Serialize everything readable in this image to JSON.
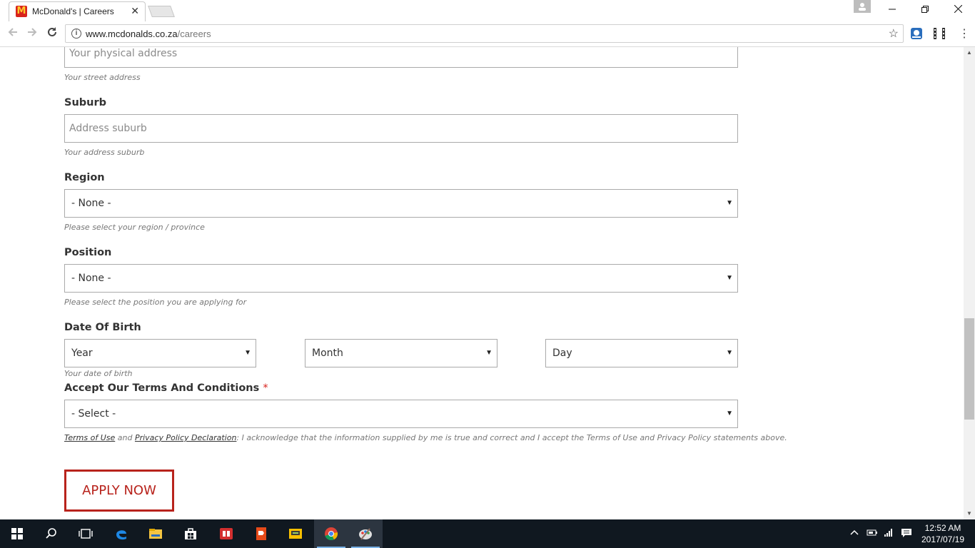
{
  "browser": {
    "tab_title": "McDonald's | Careers",
    "tab_close": "✕",
    "url_host": "www.mcdonalds.co.za",
    "url_path": "/careers"
  },
  "form": {
    "address": {
      "placeholder": "Your physical address",
      "help": "Your street address"
    },
    "suburb": {
      "label": "Suburb",
      "placeholder": "Address suburb",
      "help": "Your address suburb"
    },
    "region": {
      "label": "Region",
      "value": "- None -",
      "help": "Please select your region / province"
    },
    "position": {
      "label": "Position",
      "value": "- None -",
      "help": "Please select the position you are applying for"
    },
    "dob": {
      "label": "Date Of Birth",
      "year": "Year",
      "month": "Month",
      "day": "Day",
      "help": "Your date of birth"
    },
    "terms": {
      "label": "Accept Our Terms And Conditions",
      "required_mark": "*",
      "value": "- Select -",
      "terms_link": "Terms of Use",
      "and_text": " and ",
      "privacy_link": "Privacy Policy Declaration",
      "statement": ": I acknowledge that the information supplied by me is true and correct and I accept the Terms of Use and Privacy Policy statements above."
    },
    "apply_label": "APPLY NOW"
  },
  "taskbar": {
    "time": "12:52 AM",
    "date": "2017/07/19"
  },
  "icons": [
    "windows-start-icon",
    "search-icon",
    "task-view-icon",
    "edge-icon",
    "file-explorer-icon",
    "store-icon",
    "app-red-icon",
    "app-orange-icon",
    "app-yellow-icon",
    "chrome-icon",
    "paint-icon"
  ],
  "colors": {
    "accent": "#b8231c",
    "required": "#d8231c"
  }
}
